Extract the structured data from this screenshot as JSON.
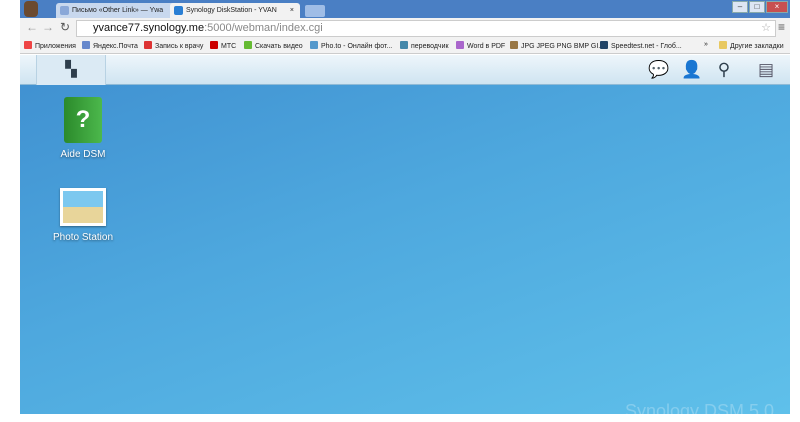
{
  "browser": {
    "tabs": [
      {
        "label": "Письмо «Other Link» — Ywa"
      },
      {
        "label": "Synology DiskStation - YVAN"
      }
    ],
    "close": "×",
    "url_host": "yvance77.synology.me",
    "url_path": ":5000/webman/index.cgi",
    "bookmarks": [
      "Приложения",
      "Яндекс.Почта",
      "Запись к врачу",
      "МТС",
      "Скачать видео",
      "Pho.to - Онлайн фот...",
      "переводчик",
      "Word в PDF",
      "JPG JPEG PNG BMP GI...",
      "Speedtest.net - Глоб..."
    ],
    "more": "»",
    "other_bookmarks": "Другие закладки"
  },
  "desktop": {
    "icons": [
      {
        "label": "Aide DSM"
      },
      {
        "label": "Photo Station"
      }
    ],
    "watermark": "Synology DSM 5.0"
  }
}
